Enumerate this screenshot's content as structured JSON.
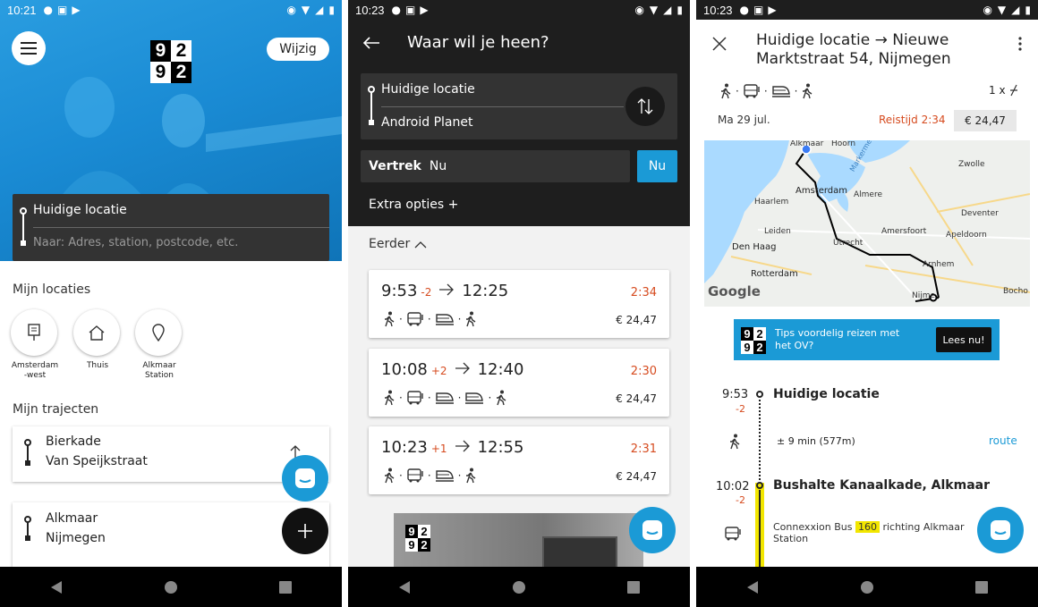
{
  "status": {
    "time1": "10:21",
    "time2": "10:23",
    "time3": "10:23"
  },
  "screen1": {
    "change_button": "Wijzig",
    "logo": [
      "9",
      "2",
      "9",
      "2"
    ],
    "from_value": "Huidige locatie",
    "to_placeholder": "Naar: Adres, station, postcode, etc.",
    "my_locations_title": "Mijn locaties",
    "locations": [
      {
        "label": "Amsterdam -west",
        "icon": "bus-stop-icon"
      },
      {
        "label": "Thuis",
        "icon": "home-icon"
      },
      {
        "label": "Alkmaar Station",
        "icon": "location-pin-icon"
      }
    ],
    "my_routes_title": "Mijn trajecten",
    "routes": [
      {
        "from": "Bierkade",
        "to": "Van Speijkstraat"
      },
      {
        "from": "Alkmaar",
        "to": "Nijmegen"
      }
    ]
  },
  "screen2": {
    "title": "Waar wil je heen?",
    "from": "Huidige locatie",
    "to": "Android Planet",
    "departure_label": "Vertrek",
    "departure_value": "Nu",
    "now_button": "Nu",
    "extra_options": "Extra opties +",
    "earlier": "Eerder",
    "trips": [
      {
        "dep": "9:53",
        "delay": "-2",
        "arr": "12:25",
        "duration": "2:34",
        "price": "€ 24,47",
        "modes": [
          "walk",
          "bus",
          "train",
          "walk"
        ]
      },
      {
        "dep": "10:08",
        "delay": "+2",
        "arr": "12:40",
        "duration": "2:30",
        "price": "€ 24,47",
        "modes": [
          "walk",
          "bus",
          "train",
          "train",
          "walk"
        ]
      },
      {
        "dep": "10:23",
        "delay": "+1",
        "arr": "12:55",
        "duration": "2:31",
        "price": "€ 24,47",
        "modes": [
          "walk",
          "bus",
          "train",
          "walk"
        ]
      }
    ]
  },
  "screen3": {
    "title": "Huidige locatie → Nieuwe Marktstraat 54, Nijmegen",
    "transfers": "1 x",
    "date": "Ma 29 jul.",
    "travel_time": "Reistijd 2:34",
    "price": "€ 24,47",
    "map_labels": {
      "alkmaar": "Alkmaar",
      "hoorn": "Hoorn",
      "zwolle": "Zwolle",
      "markermeer": "Markermeer",
      "amsterdam": "Amsterdam",
      "haarlem": "Haarlem",
      "almere": "Almere",
      "leiden": "Leiden",
      "deventer": "Deventer",
      "amersfoort": "Amersfoort",
      "apeldoorn": "Apeldoorn",
      "denhaag": "Den Haag",
      "utrecht": "Utrecht",
      "rotterdam": "Rotterdam",
      "arnhem": "Arnhem",
      "nijmegen": "Nijme",
      "bocholt": "Bocho",
      "google": "Google"
    },
    "banner_text": "Tips voordelig reizen met het OV?",
    "banner_button": "Lees nu!",
    "steps": {
      "t1": "9:53",
      "d1": "-2",
      "place1": "Huidige locatie",
      "walk": "± 9 min (577m)",
      "route": "route",
      "t2": "10:02",
      "d2": "-2",
      "place2": "Bushalte Kanaalkade, Alkmaar",
      "bus_pre": "Connexxion Bus",
      "bus_line": "160",
      "bus_post": "richting Alkmaar Station"
    }
  },
  "colors": {
    "blue": "#1b9ad6",
    "dark": "#1e1e1e",
    "delay": "#d64b1f",
    "line_yellow": "#f2e600"
  }
}
